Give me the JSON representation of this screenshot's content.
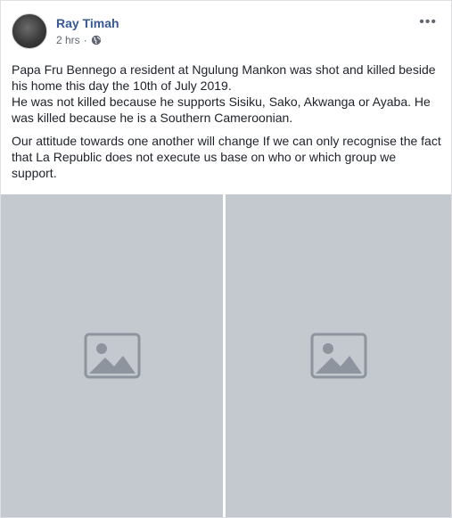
{
  "post": {
    "author": "Ray Timah",
    "time": "2 hrs",
    "separator": "·",
    "privacy_icon": "globe-icon",
    "more_icon": "ellipsis-icon",
    "more_label": "•••"
  },
  "body": {
    "paragraph1_line1": "Papa Fru Bennego a resident at Ngulung Mankon was shot and killed beside his home this day the 10th of July 2019.",
    "paragraph1_line2": "He was not killed because he supports Sisiku, Sako, Akwanga or Ayaba. He was killed because he is a Southern Cameroonian.",
    "paragraph2": "Our attitude towards one another will change If we can only recognise the fact that La Republic does not execute us base on who or which group we support."
  },
  "photos": [
    {
      "name": "photo-1"
    },
    {
      "name": "photo-2"
    }
  ],
  "colors": {
    "author": "#365899",
    "text": "#1d2129",
    "meta": "#616770",
    "placeholder": "#c4c8cf"
  }
}
